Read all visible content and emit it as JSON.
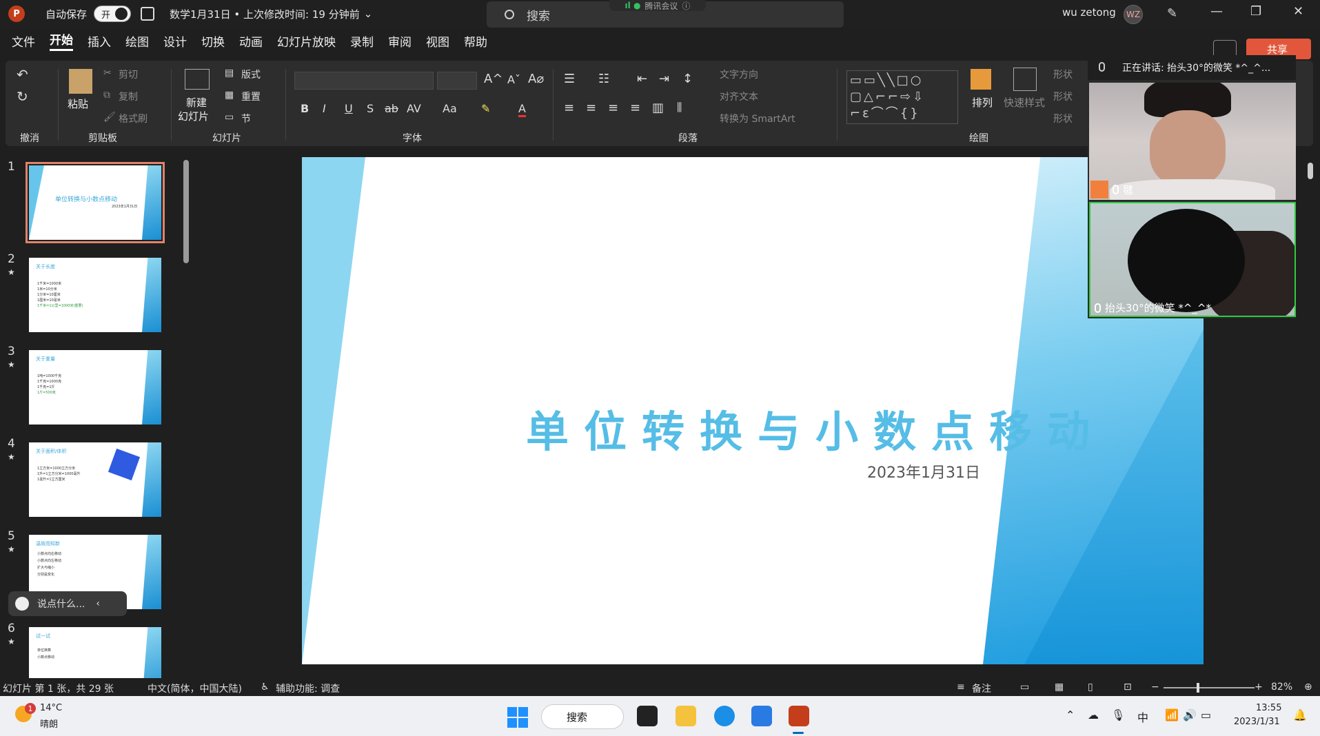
{
  "titlebar": {
    "autosave_label": "自动保存",
    "autosave_state": "开",
    "doc_info": "数学1月31日 • 上次修改时间: 19 分钟前",
    "search_placeholder": "搜索",
    "meeting_app": "腾讯会议",
    "user_name": "wu zetong",
    "user_initials": "WZ"
  },
  "menu": {
    "items": [
      "文件",
      "开始",
      "插入",
      "绘图",
      "设计",
      "切换",
      "动画",
      "幻灯片放映",
      "录制",
      "审阅",
      "视图",
      "帮助"
    ],
    "active": "开始",
    "share_label": "共享"
  },
  "ribbon": {
    "undo_group": "撤消",
    "clipboard_group": "剪贴板",
    "paste": "粘贴",
    "cut": "剪切",
    "copy": "复制",
    "format_painter": "格式刷",
    "slides_group": "幻灯片",
    "new_slide_line1": "新建",
    "new_slide_line2": "幻灯片",
    "layout": "版式",
    "reset": "重置",
    "section": "节",
    "font_group": "字体",
    "paragraph_group": "段落",
    "text_direction": "文字方向",
    "align_text": "对齐文本",
    "convert_smartart": "转换为 SmartArt",
    "drawing_group": "绘图",
    "arrange": "排列",
    "quick_styles": "快速样式",
    "shape_fill": "形状",
    "shape_outline": "形状",
    "shape_effects": "形状"
  },
  "thumbnails": [
    {
      "num": "1",
      "title": "单位转换与小数点移动",
      "lines": [
        "2023年1月31日"
      ],
      "starred": false,
      "selected": true
    },
    {
      "num": "2",
      "title": "关于长度",
      "lines": [
        "1千米=1000米",
        "1米=10分米",
        "1分米=10厘米",
        "1厘米=10毫米",
        "1千米=1公里=1000米(重要)"
      ],
      "starred": true,
      "selected": false
    },
    {
      "num": "3",
      "title": "关于重量",
      "lines": [
        "1吨=1000千克",
        "1千克=1000克",
        "1千克=1斤",
        "1斤=500克"
      ],
      "starred": true,
      "selected": false
    },
    {
      "num": "4",
      "title": "关于面积/体积",
      "lines": [
        "1立方米=1000立方分米",
        "1升=1立方分米=1000毫升",
        "1毫升=1立方厘米"
      ],
      "starred": true,
      "selected": false
    },
    {
      "num": "5",
      "title": "温故而知新",
      "lines": [
        "小数点向右移动",
        "小数点向左移动",
        "扩大与缩小",
        "分别是变化"
      ],
      "starred": true,
      "selected": false
    },
    {
      "num": "6",
      "title": "试一试",
      "lines": [
        "单位换算",
        "小数点移动"
      ],
      "starred": true,
      "selected": false
    }
  ],
  "chat_placeholder": "说点什么...",
  "slide": {
    "title": "单位转换与小数点移动",
    "date": "2023年1月31日"
  },
  "meeting": {
    "speaking": "正在讲话: 抬头30°的微笑 *^_^...",
    "participant1": "毽",
    "participant2": "抬头30°的微笑 *^_^*"
  },
  "statusbar": {
    "slide_info": "幻灯片 第 1 张，共 29 张",
    "language": "中文(简体，中国大陆)",
    "accessibility": "辅助功能: 调查",
    "notes": "备注",
    "zoom": "82%",
    "zoom_level": 0.82
  },
  "taskbar": {
    "temperature": "14°C",
    "weather": "晴朗",
    "badge": "1",
    "search": "搜索",
    "ime": "中",
    "time": "13:55",
    "date": "2023/1/31"
  }
}
